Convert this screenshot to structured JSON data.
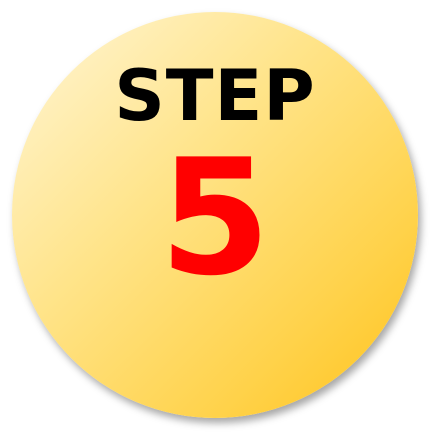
{
  "badge": {
    "label": "STEP",
    "number": "5",
    "colors": {
      "fill_light": "#fff6d8",
      "fill_dark": "#ffc21a",
      "label": "#000000",
      "number": "#ff0000"
    }
  }
}
